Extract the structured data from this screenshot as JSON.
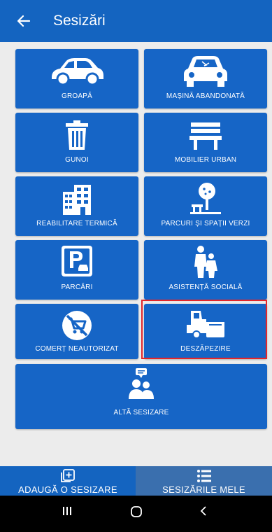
{
  "header": {
    "title": "Sesizări",
    "back_icon": "arrow-left-icon"
  },
  "tiles": [
    {
      "label": "GROAPĂ",
      "icon": "car-icon"
    },
    {
      "label": "MAȘINĂ ABANDONATĂ",
      "icon": "wrecked-car-icon"
    },
    {
      "label": "GUNOI",
      "icon": "trash-can-icon"
    },
    {
      "label": "MOBILIER URBAN",
      "icon": "bench-icon"
    },
    {
      "label": "REABILITARE TERMICĂ",
      "icon": "building-icon"
    },
    {
      "label": "PARCURI ȘI SPAȚII VERZI",
      "icon": "tree-bench-icon"
    },
    {
      "label": "PARCĂRI",
      "icon": "parking-sign-icon"
    },
    {
      "label": "ASISTENȚĂ SOCIALĂ",
      "icon": "family-icon"
    },
    {
      "label": "COMERȚ NEAUTORIZAT",
      "icon": "no-cart-icon"
    },
    {
      "label": "DESZĂPEZIRE",
      "icon": "snowplow-icon"
    },
    {
      "label": "ALTĂ SESIZARE",
      "icon": "people-speech-icon"
    }
  ],
  "bottom_tabs": [
    {
      "label": "ADAUGĂ O SESIZARE",
      "icon": "add-square-icon",
      "active": true
    },
    {
      "label": "SESIZĂRILE MELE",
      "icon": "list-icon",
      "active": false
    }
  ],
  "colors": {
    "primary": "#1464c0",
    "tile": "#1665c6",
    "background": "#ececec",
    "highlight": "#e3262b",
    "tab_inactive": "#3a6fae"
  },
  "system_nav": {
    "recent": "recents-icon",
    "home": "home-icon",
    "back": "nav-back-icon"
  }
}
